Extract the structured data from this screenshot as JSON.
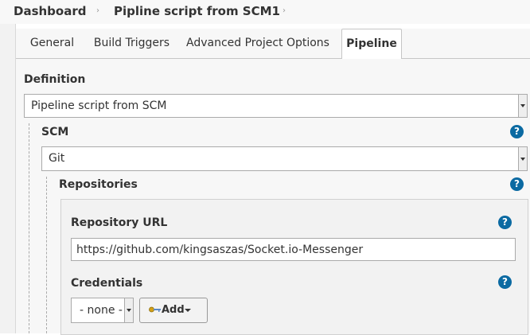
{
  "breadcrumb": {
    "items": [
      "Dashboard",
      "Pipline script from SCM1"
    ],
    "separator": "›"
  },
  "tabs": [
    {
      "label": "General",
      "active": false
    },
    {
      "label": "Build Triggers",
      "active": false
    },
    {
      "label": "Advanced Project Options",
      "active": false
    },
    {
      "label": "Pipeline",
      "active": true
    }
  ],
  "definition": {
    "label": "Definition",
    "selected": "Pipeline script from SCM"
  },
  "scm": {
    "label": "SCM",
    "selected": "Git",
    "help_icon": "question-mark-icon"
  },
  "repositories": {
    "label": "Repositories",
    "help_icon": "question-mark-icon",
    "repository_url": {
      "label": "Repository URL",
      "value": "https://github.com/kingsaszas/Socket.io-Messenger"
    },
    "credentials": {
      "label": "Credentials",
      "selected": "- none -",
      "add_label": "Add",
      "add_icon": "key-icon"
    }
  },
  "colors": {
    "help_icon": "#0b6aa2",
    "tab_bar_bg": "#f7f7f7",
    "panel_bg": "#f7f7f7"
  }
}
